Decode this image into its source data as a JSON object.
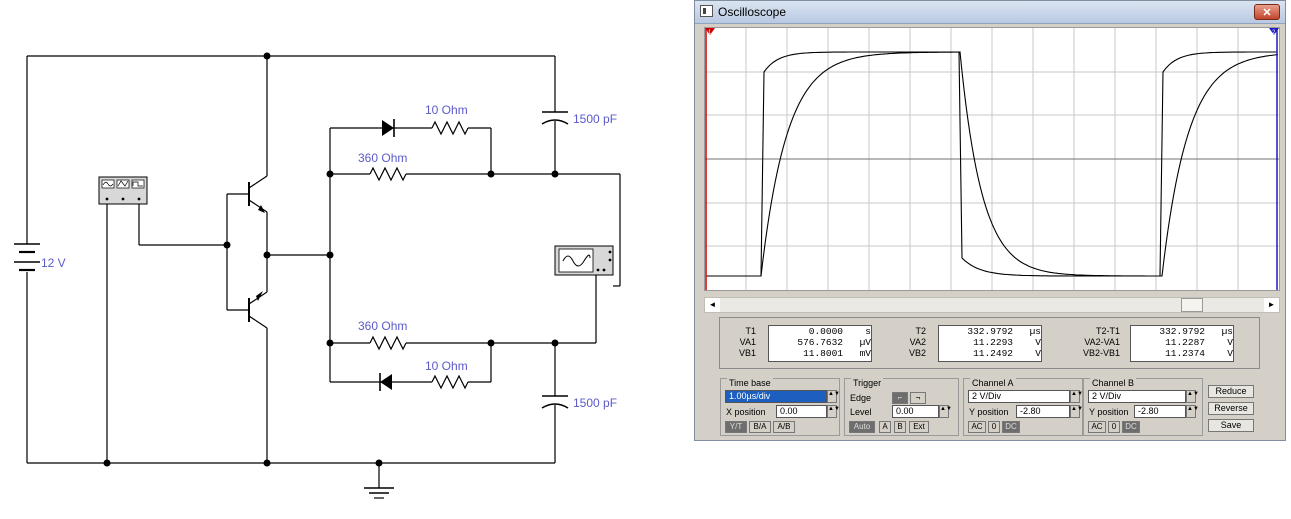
{
  "circuit": {
    "labels": {
      "c_top": "1500 pF",
      "c_bottom": "1500 pF",
      "r_top_10": "10 Ohm",
      "r_top_360": "360 Ohm",
      "r_bot_360": "360 Ohm",
      "r_bot_10": "10 Ohm",
      "battery": "12 V"
    }
  },
  "oscilloscope": {
    "title": "Oscilloscope",
    "close_label": "✕",
    "cursor1_label": "1",
    "cursor2_label": "2",
    "trace_color": "#000000",
    "cursor1_color": "#cc0000",
    "cursor2_color": "#1c1cc0",
    "readout": {
      "t1": {
        "label": "T1",
        "value": "0.0000",
        "unit": "s"
      },
      "va1": {
        "label": "VA1",
        "value": "576.7632",
        "unit": "µV"
      },
      "vb1": {
        "label": "VB1",
        "value": "11.8001",
        "unit": "mV"
      },
      "t2": {
        "label": "T2",
        "value": "332.9792",
        "unit": "µs"
      },
      "va2": {
        "label": "VA2",
        "value": "11.2293",
        "unit": "V"
      },
      "vb2": {
        "label": "VB2",
        "value": "11.2492",
        "unit": "V"
      },
      "dt": {
        "label": "T2-T1",
        "value": "332.9792",
        "unit": "µs"
      },
      "dva": {
        "label": "VA2-VA1",
        "value": "11.2287",
        "unit": "V"
      },
      "dvb": {
        "label": "VB2-VB1",
        "value": "11.2374",
        "unit": "V"
      }
    },
    "timebase": {
      "title": "Time base",
      "value": "1.00µs/div",
      "xpos_label": "X position",
      "xpos_value": "0.00",
      "buttons": [
        "Y/T",
        "B/A",
        "A/B"
      ]
    },
    "trigger": {
      "title": "Trigger",
      "edge_label": "Edge",
      "level_label": "Level",
      "level_value": "0.00",
      "buttons": [
        "Auto",
        "A",
        "B",
        "Ext"
      ]
    },
    "channel_a": {
      "title": "Channel A",
      "scale": "2 V/Div",
      "ypos_label": "Y position",
      "ypos_value": "-2.80",
      "buttons": [
        "AC",
        "0",
        "DC"
      ]
    },
    "channel_b": {
      "title": "Channel B",
      "scale": "2 V/Div",
      "ypos_label": "Y position",
      "ypos_value": "-2.80",
      "buttons": [
        "AC",
        "0",
        "DC"
      ]
    },
    "side_buttons": [
      "Reduce",
      "Reverse",
      "Save"
    ]
  }
}
